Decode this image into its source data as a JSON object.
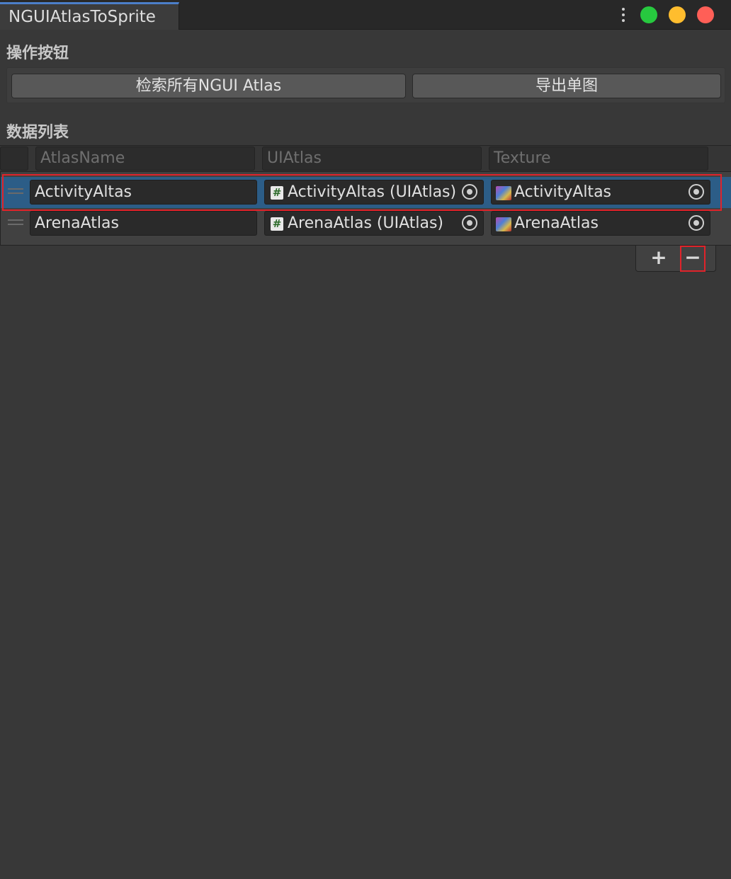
{
  "window": {
    "tab_title": "NGUIAtlasToSprite",
    "colors": {
      "close": "#ff5f57",
      "minimize": "#ffbd2e",
      "maximize": "#27c93f",
      "selection": "#2c5d87",
      "highlight": "#e0232a"
    }
  },
  "actions": {
    "section_title": "操作按钮",
    "search_button": "检索所有NGUI Atlas",
    "export_button": "导出单图"
  },
  "data_list": {
    "section_title": "数据列表",
    "columns": [
      "AtlasName",
      "UIAtlas",
      "Texture"
    ],
    "rows": [
      {
        "atlas_name": "ActivityAltas",
        "ui_atlas": "ActivityAltas (UIAtlas)",
        "texture": "ActivityAltas",
        "selected": true
      },
      {
        "atlas_name": "ArenaAtlas",
        "ui_atlas": "ArenaAtlas (UIAtlas)",
        "texture": "ArenaAtlas",
        "selected": false
      }
    ],
    "add_icon": "plus-icon",
    "remove_icon": "minus-icon"
  }
}
